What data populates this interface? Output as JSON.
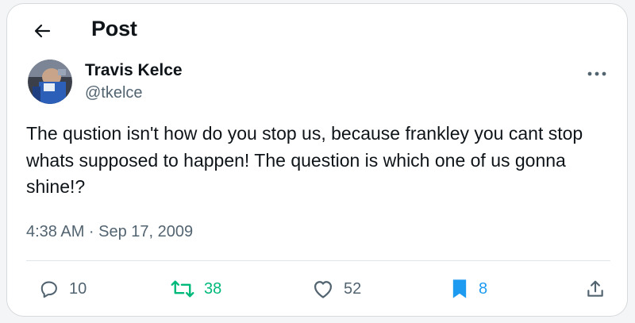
{
  "header": {
    "title": "Post",
    "back_icon": "arrow-left-icon"
  },
  "author": {
    "name": "Travis Kelce",
    "handle": "@tkelce",
    "avatar_icon": "avatar-photo"
  },
  "tweet": {
    "text": "The qustion isn't how do you stop us, because frankley you cant stop whats supposed to happen! The question is which one of us gonna shine!?",
    "timestamp": "4:38 AM · Sep 17, 2009"
  },
  "actions": {
    "reply": {
      "icon": "reply-icon",
      "count": "10"
    },
    "retweet": {
      "icon": "retweet-icon",
      "count": "38",
      "color": "#00ba7c"
    },
    "like": {
      "icon": "heart-icon",
      "count": "52"
    },
    "bookmark": {
      "icon": "bookmark-icon",
      "count": "8",
      "color": "#1d9bf0"
    },
    "share": {
      "icon": "share-icon"
    }
  },
  "colors": {
    "text": "#0f1419",
    "secondary": "#536471",
    "retweet_active": "#00ba7c",
    "bookmark_active": "#1d9bf0"
  }
}
